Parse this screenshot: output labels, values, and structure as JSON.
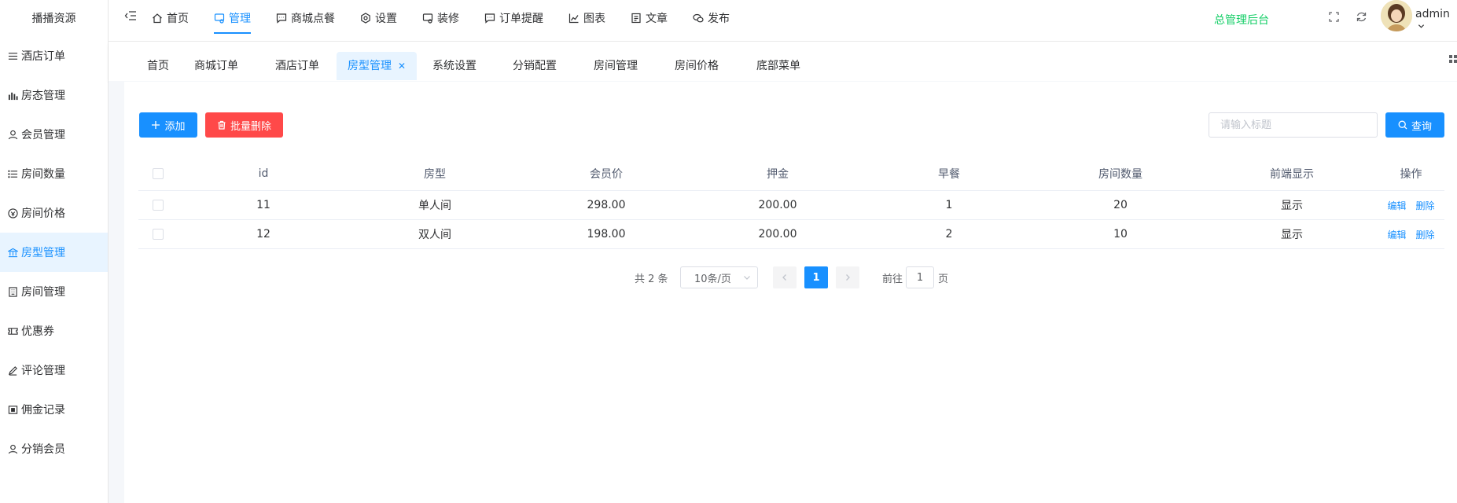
{
  "sidebar": {
    "logo": "播播资源",
    "items": [
      {
        "label": "酒店订单",
        "icon": "list-icon"
      },
      {
        "label": "房态管理",
        "icon": "bar-chart-icon"
      },
      {
        "label": "会员管理",
        "icon": "user-icon"
      },
      {
        "label": "房间数量",
        "icon": "list-icon"
      },
      {
        "label": "房间价格",
        "icon": "price-icon"
      },
      {
        "label": "房型管理",
        "icon": "bank-icon",
        "active": true
      },
      {
        "label": "房间管理",
        "icon": "building-icon"
      },
      {
        "label": "优惠券",
        "icon": "ticket-icon"
      },
      {
        "label": "评论管理",
        "icon": "edit-icon"
      },
      {
        "label": "佣金记录",
        "icon": "wallet-icon"
      },
      {
        "label": "分销会员",
        "icon": "user-icon"
      }
    ]
  },
  "topbar": {
    "menu": [
      {
        "label": "首页",
        "icon": "home-icon"
      },
      {
        "label": "管理",
        "icon": "monitor-icon",
        "active": true
      },
      {
        "label": "商城点餐",
        "icon": "chat-icon"
      },
      {
        "label": "设置",
        "icon": "gear-icon"
      },
      {
        "label": "装修",
        "icon": "monitor-icon"
      },
      {
        "label": "订单提醒",
        "icon": "chat-icon"
      },
      {
        "label": "图表",
        "icon": "line-chart-icon"
      },
      {
        "label": "文章",
        "icon": "document-icon"
      },
      {
        "label": "发布",
        "icon": "wechat-icon"
      }
    ],
    "admin_title": "总管理后台",
    "username": "admin"
  },
  "tabs": [
    {
      "label": "首页"
    },
    {
      "label": "商城订单"
    },
    {
      "label": "酒店订单"
    },
    {
      "label": "房型管理",
      "active": true,
      "closable": true
    },
    {
      "label": "系统设置"
    },
    {
      "label": "分销配置"
    },
    {
      "label": "房间管理"
    },
    {
      "label": "房间价格"
    },
    {
      "label": "底部菜单"
    }
  ],
  "toolbar": {
    "add_label": "添加",
    "batch_delete_label": "批量删除",
    "search_placeholder": "请输入标题",
    "search_label": "查询"
  },
  "table": {
    "headers": [
      "id",
      "房型",
      "会员价",
      "押金",
      "早餐",
      "房间数量",
      "前端显示",
      "操作"
    ],
    "rows": [
      {
        "id": "11",
        "type": "单人间",
        "price": "298.00",
        "deposit": "200.00",
        "breakfast": "1",
        "count": "20",
        "display": "显示"
      },
      {
        "id": "12",
        "type": "双人间",
        "price": "198.00",
        "deposit": "200.00",
        "breakfast": "2",
        "count": "10",
        "display": "显示"
      }
    ],
    "edit_label": "编辑",
    "delete_label": "删除"
  },
  "pagination": {
    "total_text": "共 2 条",
    "page_size": "10条/页",
    "current_page": "1",
    "goto_label": "前往",
    "goto_value": "1",
    "page_unit": "页"
  },
  "colors": {
    "primary": "#1890ff",
    "danger": "#ff4949",
    "success": "#13ce66"
  }
}
